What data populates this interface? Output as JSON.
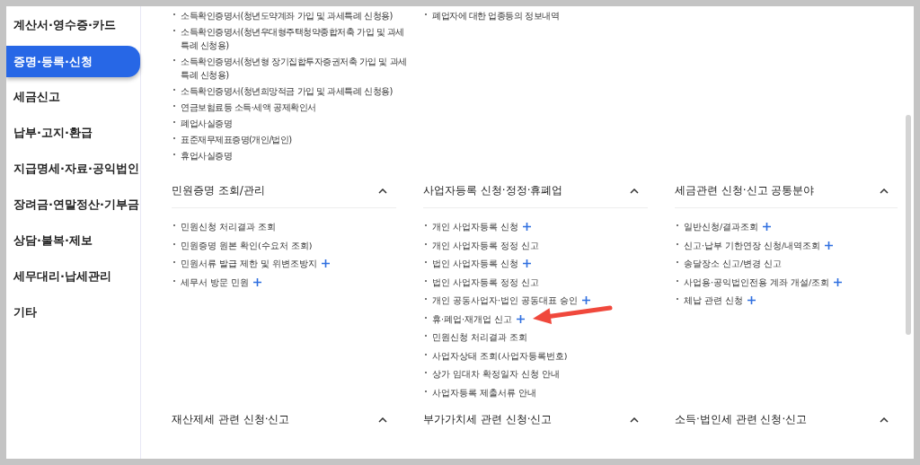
{
  "sidebar": {
    "items": [
      {
        "label": "계산서·영수증·카드",
        "selected": false
      },
      {
        "label": "증명·등록·신청",
        "selected": true
      },
      {
        "label": "세금신고",
        "selected": false
      },
      {
        "label": "납부·고지·환급",
        "selected": false
      },
      {
        "label": "지급명세·자료·공익법인",
        "selected": false
      },
      {
        "label": "장려금·연말정산·기부금",
        "selected": false
      },
      {
        "label": "상담·불복·제보",
        "selected": false
      },
      {
        "label": "세무대리·납세관리",
        "selected": false
      },
      {
        "label": "기타",
        "selected": false
      }
    ]
  },
  "top_lists": [
    [
      {
        "text": "소득확인증명서(청년도약계좌 가입 및 과세특례 신청용)"
      },
      {
        "text": "소득확인증명서(청년우대형주택청약종합저축 가입 및 과세특례 신청용)"
      },
      {
        "text": "소득확인증명서(청년형 장기집합투자증권저축 가입 및 과세특례 신청용)"
      },
      {
        "text": "소득확인증명서(청년희망적금 가입 및 과세특례 신청용)"
      },
      {
        "text": "연금보험료등 소득·세액 공제확인서"
      },
      {
        "text": "폐업사실증명"
      },
      {
        "text": "표준재무제표증명(개인/법인)"
      },
      {
        "text": "휴업사실증명"
      }
    ],
    [
      {
        "text": "폐업자에 대한 업종등의 정보내역"
      }
    ]
  ],
  "sections": [
    {
      "title": "민원증명 조회/관리",
      "expanded": true,
      "items": [
        {
          "text": "민원신청 처리결과 조회",
          "plus": false
        },
        {
          "text": "민원증명 원본 확인(수요처 조회)",
          "plus": false
        },
        {
          "text": "민원서류 발급 제한 및 위변조방지",
          "plus": true
        },
        {
          "text": "세무서 방문 민원",
          "plus": true
        }
      ]
    },
    {
      "title": "사업자등록 신청·정정·휴폐업",
      "expanded": true,
      "items": [
        {
          "text": "개인 사업자등록 신청",
          "plus": true
        },
        {
          "text": "개인 사업자등록 정정 신고",
          "plus": false
        },
        {
          "text": "법인 사업자등록 신청",
          "plus": true
        },
        {
          "text": "법인 사업자등록 정정 신고",
          "plus": false
        },
        {
          "text": "개인 공동사업자·법인 공동대표 승인",
          "plus": true
        },
        {
          "text": "휴·폐업·재개업 신고",
          "plus": true
        },
        {
          "text": "민원신청 처리결과 조회",
          "plus": false
        },
        {
          "text": "사업자상태 조회(사업자등록번호)",
          "plus": false
        },
        {
          "text": "상가 임대차 확정일자 신청 안내",
          "plus": false
        },
        {
          "text": "사업자등록 제출서류 안내",
          "plus": false
        }
      ]
    },
    {
      "title": "세금관련 신청·신고 공통분야",
      "expanded": true,
      "items": [
        {
          "text": "일반신청/결과조회",
          "plus": true
        },
        {
          "text": "신고·납부 기한연장 신청/내역조회",
          "plus": true
        },
        {
          "text": "송달장소 신고/변경 신고",
          "plus": false
        },
        {
          "text": "사업용·공익법인전용 계좌 개설/조회",
          "plus": true
        },
        {
          "text": "체납 관련 신청",
          "plus": true
        }
      ]
    },
    {
      "title": "재산제세 관련 신청·신고",
      "expanded": true
    },
    {
      "title": "부가가치세 관련 신청·신고",
      "expanded": true
    },
    {
      "title": "소득·법인세 관련 신청·신고",
      "expanded": true
    }
  ]
}
